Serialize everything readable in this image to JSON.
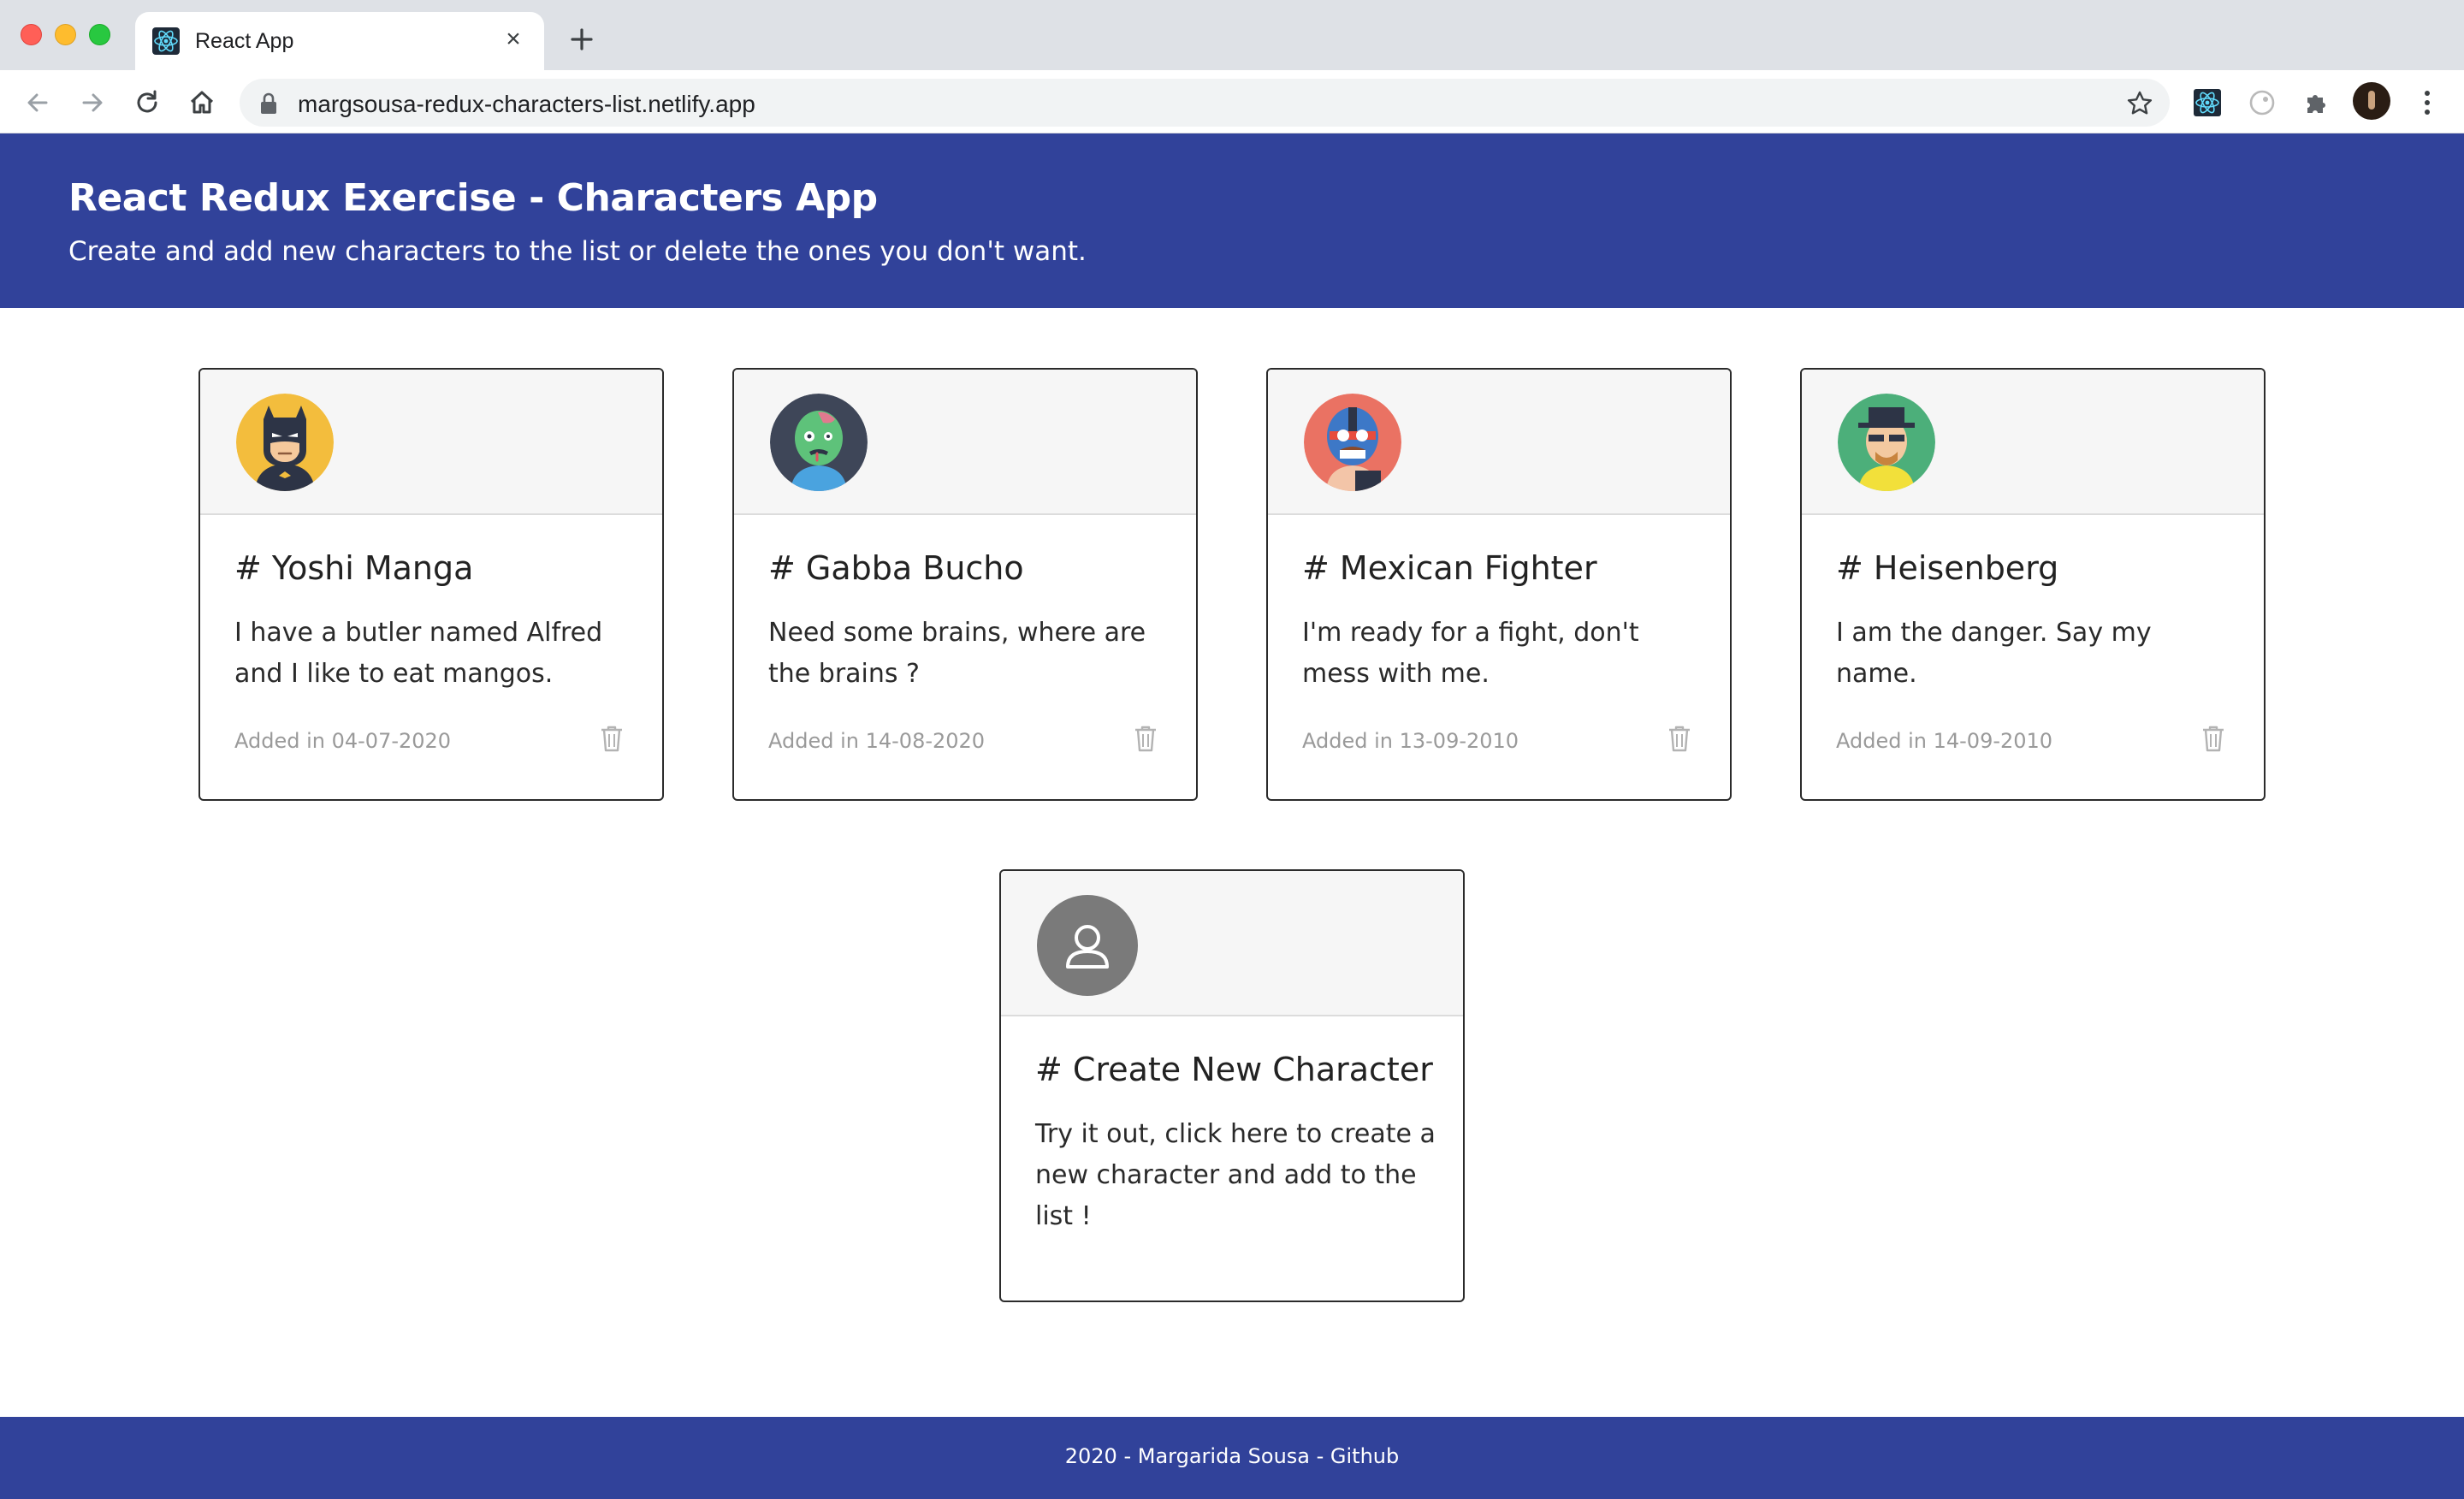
{
  "browser": {
    "tab_title": "React App",
    "tab_close": "×",
    "url": "margsousa-redux-characters-list.netlify.app"
  },
  "header": {
    "title": "React Redux Exercise - Characters App",
    "subtitle": "Create and add new characters to the list or delete the ones you don't want."
  },
  "characters": [
    {
      "title": "# Yoshi Manga",
      "description": "I have a butler named Alfred and I like to eat mangos.",
      "date": "Added in 04-07-2020",
      "avatar": "batman-avatar"
    },
    {
      "title": "# Gabba Bucho",
      "description": "Need some brains, where are the brains ?",
      "date": "Added in 14-08-2020",
      "avatar": "zombie-avatar"
    },
    {
      "title": "# Mexican Fighter",
      "description": "I'm ready for a fight, don't mess with me.",
      "date": "Added in 13-09-2010",
      "avatar": "luchador-avatar"
    },
    {
      "title": "# Heisenberg",
      "description": "I am the danger. Say my name.",
      "date": "Added in 14-09-2010",
      "avatar": "heisenberg-avatar"
    }
  ],
  "create_card": {
    "title": "# Create New Character",
    "description": "Try it out, click here to create a new character and add to the list !",
    "avatar": "user-placeholder-icon"
  },
  "footer": {
    "text": "2020 - Margarida Sousa - Github"
  },
  "colors": {
    "brand": "#31429a",
    "card_border": "#2b2b2b",
    "card_header_bg": "#f6f6f6",
    "muted_text": "#9a9a9a"
  }
}
